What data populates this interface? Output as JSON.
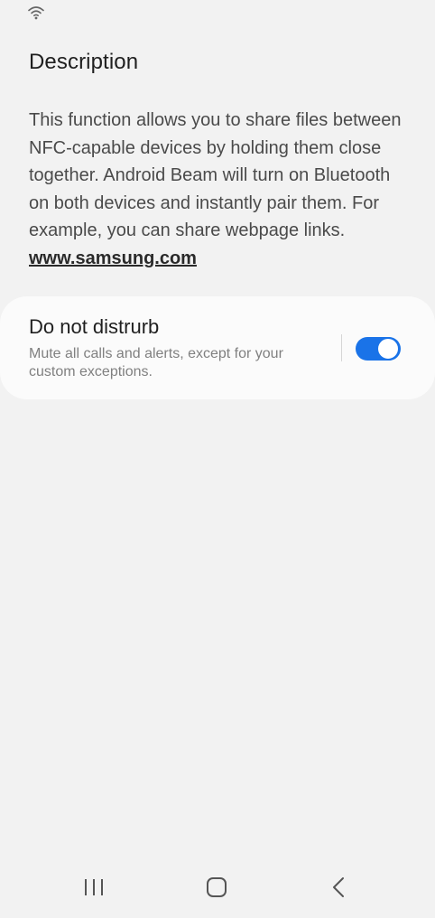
{
  "status_bar": {
    "icons": [
      "wifi-icon"
    ]
  },
  "description": {
    "title": "Description",
    "body": "This function allows you to share files between NFC-capable devices by holding them close together. Android Beam will turn on Bluetooth on both devices and instantly pair them. For example, you can share webpage links. ",
    "link_text": "www.samsung.com"
  },
  "dnd": {
    "title": "Do not distrurb",
    "subtitle": "Mute all calls and alerts, except for your custom exceptions.",
    "enabled": true
  },
  "nav_bar": {
    "icons": [
      "recent-apps-icon",
      "home-icon",
      "back-icon"
    ]
  },
  "colors": {
    "background": "#f2f2f2",
    "card": "#fbfbfb",
    "accent": "#1a73e8"
  }
}
